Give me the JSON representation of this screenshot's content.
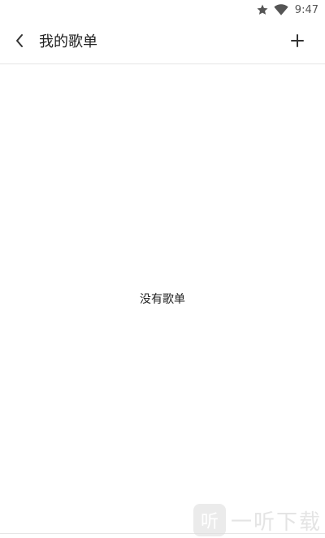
{
  "status_bar": {
    "time": "9:47",
    "icons": [
      "star-icon",
      "wifi-icon"
    ]
  },
  "app_bar": {
    "title": "我的歌单",
    "back_icon": "chevron-left-icon",
    "add_icon": "plus-icon"
  },
  "main": {
    "empty_message": "没有歌单"
  },
  "watermark": {
    "badge_char": "听",
    "text": "一听下载"
  }
}
